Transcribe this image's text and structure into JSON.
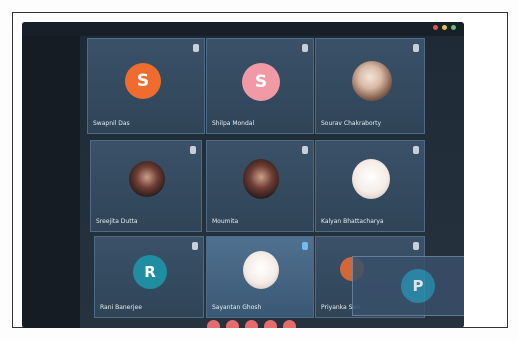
{
  "meeting": {
    "accent_color": "#ef6c2f",
    "participants": [
      {
        "name": "Swapnil Das",
        "initial": "S",
        "avatar_color": "#ef6c2f",
        "avatar_type": "initial"
      },
      {
        "name": "Shilpa Mondal",
        "initial": "S",
        "avatar_color": "#f19aa6",
        "avatar_type": "initial"
      },
      {
        "name": "Sourav Chakraborty",
        "initial": "",
        "avatar_color": "",
        "avatar_type": "photo"
      },
      {
        "name": "Sreejita Dutta",
        "initial": "",
        "avatar_color": "",
        "avatar_type": "photo-dark"
      },
      {
        "name": "Moumita",
        "initial": "",
        "avatar_color": "",
        "avatar_type": "photo"
      },
      {
        "name": "Kalyan Bhattacharya",
        "initial": "",
        "avatar_color": "",
        "avatar_type": "photo-light"
      },
      {
        "name": "Rani Banerjee",
        "initial": "R",
        "avatar_color": "#1f8ea0",
        "avatar_type": "initial"
      },
      {
        "name": "Sayantan Ghosh",
        "initial": "",
        "avatar_color": "",
        "avatar_type": "photo-light"
      },
      {
        "name": "Priyanka Sen",
        "initial": "P",
        "avatar_color": "#2a8fb0",
        "avatar_type": "initial"
      }
    ],
    "controls": [
      "mic-icon",
      "video-icon",
      "share-icon",
      "chat-icon",
      "end-call-icon"
    ]
  }
}
